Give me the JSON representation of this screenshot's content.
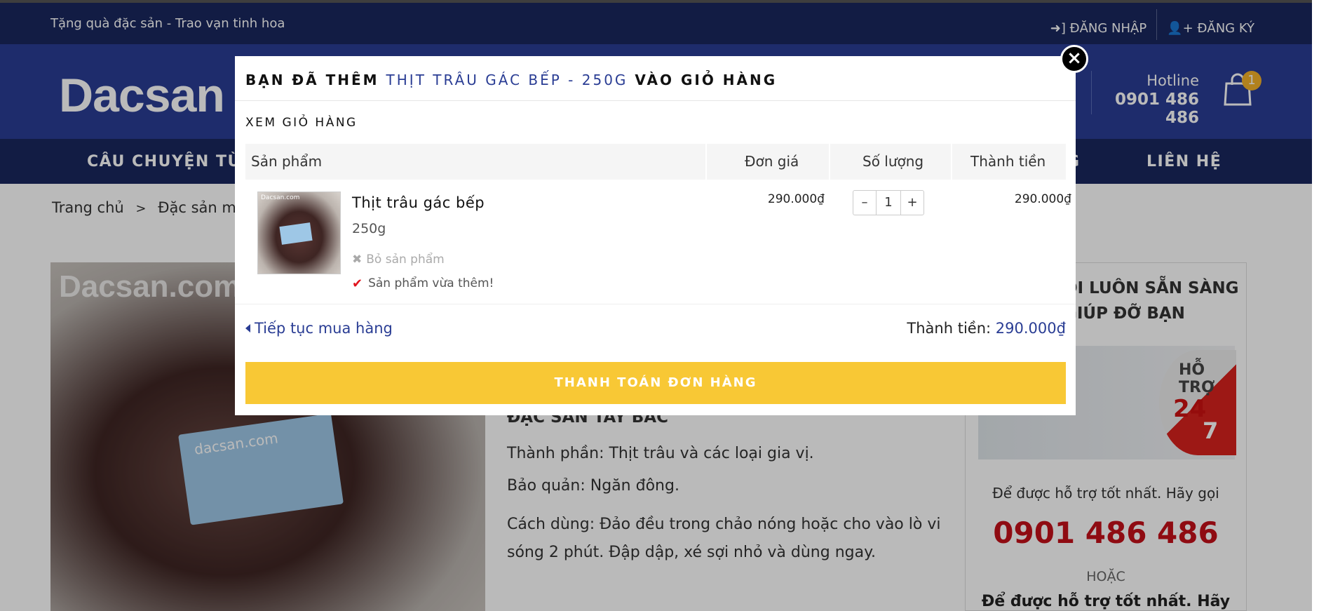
{
  "topbar": {
    "tagline": "Tặng quà đặc sản - Trao vạn tinh hoa",
    "login": "ĐĂNG NHẬP",
    "register": "ĐĂNG KÝ"
  },
  "header": {
    "logo": "Dacsan",
    "hotline_label": "Hotline",
    "hotline_number": "0901 486 486",
    "cart_count": "1"
  },
  "nav": {
    "item_story": "CÂU CHUYỆN TỪ Đ",
    "item_partial": "G",
    "item_contact": "LIÊN HỆ"
  },
  "breadcrumb": {
    "home": "Trang chủ",
    "separator": ">",
    "category": "Đặc sản miền"
  },
  "product_image": {
    "watermark": "Dacsan.com",
    "card_text": "dacsan.com"
  },
  "description": {
    "heading": "ĐẶC SẢN TÂY BẮC",
    "ingredients": "Thành phần: Thịt trâu và các loại gia vị.",
    "storage": "Bảo quản: Ngăn đông.",
    "usage": "Cách dùng: Đảo đều trong chảo nóng hoặc cho vào lò vi sóng 2 phút. Đập dập, xé sợi nhỏ và dùng ngay."
  },
  "support": {
    "title_line1": "ÔI LUÔN SẴN SÀNG",
    "title_line2": "GIÚP ĐỠ BẠN",
    "badge_line1": "HỖ TRỢ",
    "badge_num1": "24",
    "badge_num2": "7",
    "call_text": "Để được hỗ trợ tốt nhất. Hãy gọi",
    "phone": "0901 486 486",
    "or_text": "HOẶC",
    "call_text2": "Để được hỗ trợ tốt nhất. Hãy gọi"
  },
  "modal": {
    "heading_prefix": "BẠN ĐÃ THÊM",
    "heading_product": "THỊT TRÂU GÁC BẾP - 250G",
    "heading_suffix": "VÀO GIỎ HÀNG",
    "view_cart": "XEM GIỎ HÀNG",
    "columns": {
      "product": "Sản phẩm",
      "unit_price": "Đơn giá",
      "quantity": "Số lượng",
      "line_total": "Thành tiền"
    },
    "item": {
      "thumb_label": "Dacsan.com",
      "name": "Thịt trâu gác bếp",
      "variant": "250g",
      "remove": "Bỏ sản phẩm",
      "added_notice": "Sản phẩm vừa thêm!",
      "price": "290.000₫",
      "qty_minus": "–",
      "qty_value": "1",
      "qty_plus": "+",
      "total": "290.000₫"
    },
    "continue_shopping": "Tiếp tục mua hàng",
    "summary_label": "Thành tiền:",
    "summary_value": "290.000₫",
    "checkout": "THANH TOÁN ĐƠN HÀNG",
    "close": "×"
  },
  "colors": {
    "navy": "#19275e",
    "header_blue": "#2a3d94",
    "checkout_yellow": "#f8c835",
    "accent_red": "#c4101a"
  }
}
